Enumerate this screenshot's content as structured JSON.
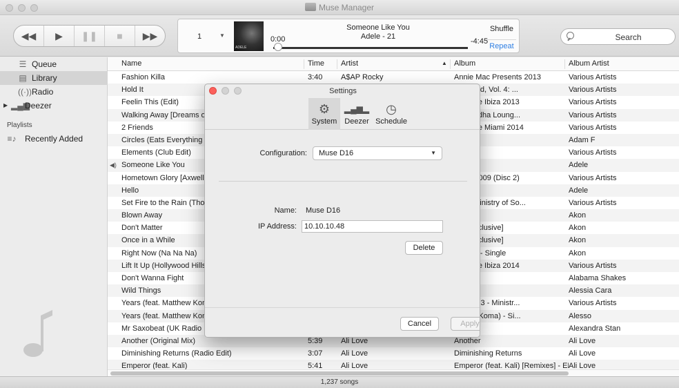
{
  "window": {
    "title": "Muse Manager"
  },
  "toolbar": {
    "zone": "1",
    "elapsed": "0:00",
    "now_playing_title": "Someone Like You",
    "now_playing_sub": "Adele - 21",
    "art_text": "ADELE",
    "remaining": "-4:45",
    "progress": 0.0,
    "shuffle": "Shuffle",
    "repeat": "Repeat",
    "search_placeholder": "Search",
    "accent": "#2f7fe3"
  },
  "sidebar": {
    "items": [
      {
        "label": "Queue",
        "icon": "list-icon"
      },
      {
        "label": "Library",
        "icon": "library-icon"
      },
      {
        "label": "Radio",
        "icon": "radio-icon"
      },
      {
        "label": "Deezer",
        "icon": "deezer-icon"
      }
    ],
    "playlists_heading": "Playlists",
    "playlists": [
      {
        "label": "Recently Added",
        "icon": "playlist-icon"
      }
    ]
  },
  "table": {
    "columns": [
      "Name",
      "Time",
      "Artist",
      "Album",
      "Album Artist"
    ],
    "rows": [
      [
        "Fashion Killa",
        "3:40",
        "A$AP Rocky",
        "Annie Mac Presents 2013",
        "Various Artists"
      ],
      [
        "Hold It",
        "",
        "",
        "Defected, Vol. 4: ...",
        "Various Artists"
      ],
      [
        "Feelin This (Edit)",
        "",
        "",
        "e House Ibiza 2013",
        "Various Artists"
      ],
      [
        "Walking Away [Dreams of",
        "",
        "",
        "ut [Buddha Loung...",
        "Various Artists"
      ],
      [
        "2 Friends",
        "",
        "",
        "e House Miami 2014",
        "Various Artists"
      ],
      [
        "Circles (Eats Everything R",
        "",
        "",
        "",
        "Adam F"
      ],
      [
        "Elements (Club Edit)",
        "",
        "",
        "ure 2",
        "Various Artists"
      ],
      [
        "Someone Like You",
        "",
        "",
        "",
        "Adele"
      ],
      [
        "Hometown Glory [Axwell",
        "",
        "",
        "e Mix 2009 (Disc 2)",
        "Various Artists"
      ],
      [
        "Hello",
        "",
        "",
        "",
        "Adele"
      ],
      [
        "Set Fire to the Rain (Thon",
        "",
        "",
        "012 - Ministry of So...",
        "Various Artists"
      ],
      [
        "Blown Away",
        "",
        "",
        "",
        "Akon"
      ],
      [
        "Don't Matter",
        "",
        "",
        "rget Exclusive]",
        "Akon"
      ],
      [
        "Once in a While",
        "",
        "",
        "rget Exclusive]",
        "Akon"
      ],
      [
        "Right Now (Na Na Na)",
        "",
        "",
        "Na Na) - Single",
        "Akon"
      ],
      [
        "Lift It Up (Hollywood Hills",
        "",
        "",
        "e House Ibiza 2014",
        "Various Artists"
      ],
      [
        "Don't Wanna Fight",
        "",
        "",
        "r",
        "Alabama Shakes"
      ],
      [
        "Wild Things",
        "",
        "",
        "Single",
        "Alessia Cara"
      ],
      [
        "Years (feat. Matthew Kon",
        "",
        "",
        "ass 2013 - Ministr...",
        "Various Artists"
      ],
      [
        "Years (feat. Matthew Kon",
        "",
        "",
        "atthew Koma) - Si...",
        "Alesso"
      ],
      [
        "Mr Saxobeat (UK Radio E",
        "",
        "",
        "EP",
        "Alexandra Stan"
      ],
      [
        "Another (Original Mix)",
        "5:39",
        "Ali Love",
        "Another",
        "Ali Love"
      ],
      [
        "Diminishing Returns (Radio Edit)",
        "3:07",
        "Ali Love",
        "Diminishing Returns",
        "Ali Love"
      ],
      [
        "Emperor (feat. Kali)",
        "5:41",
        "Ali Love",
        "Emperor (feat. Kali) [Remixes] - EP",
        "Ali Love"
      ]
    ],
    "playing_row": 7
  },
  "status": {
    "song_count": "1,237 songs"
  },
  "dialog": {
    "title": "Settings",
    "tabs": [
      {
        "label": "System",
        "icon": "gears-icon"
      },
      {
        "label": "Deezer",
        "icon": "deezer-icon"
      },
      {
        "label": "Schedule",
        "icon": "clock-icon"
      }
    ],
    "configuration_label": "Configuration:",
    "configuration_value": "Muse D16",
    "name_label": "Name:",
    "name_value": "Muse D16",
    "ip_label": "IP Address:",
    "ip_value": "10.10.10.48",
    "delete_label": "Delete",
    "cancel_label": "Cancel",
    "apply_label": "Apply",
    "close_color": "#fc605b"
  }
}
